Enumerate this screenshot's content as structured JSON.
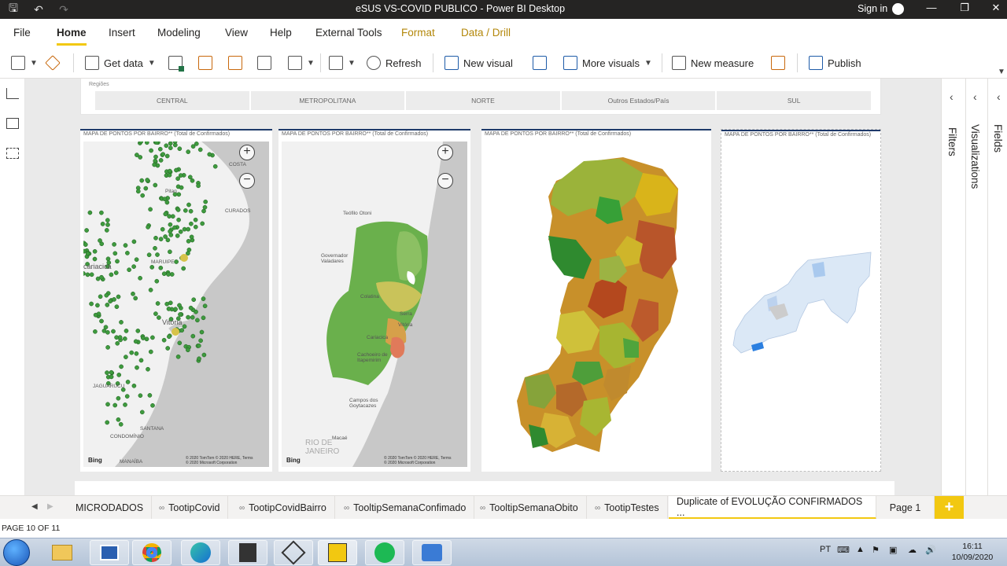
{
  "window": {
    "title": "eSUS VS-COVID PUBLICO - Power BI Desktop",
    "sign_in": "Sign in"
  },
  "ribbon_tabs": [
    "File",
    "Home",
    "Insert",
    "Modeling",
    "View",
    "Help",
    "External Tools",
    "Format",
    "Data / Drill"
  ],
  "active_ribbon_tab": "Home",
  "ribbon": {
    "get_data": "Get data",
    "refresh": "Refresh",
    "new_visual": "New visual",
    "more_visuals": "More visuals",
    "new_measure": "New measure",
    "publish": "Publish"
  },
  "slicer": {
    "title": "Regiões",
    "items": [
      "CENTRAL",
      "METROPOLITANA",
      "NORTE",
      "Outros Estados/País",
      "SUL"
    ]
  },
  "visuals": {
    "map1": {
      "title": "MAPA DE PONTOS POR BAIRRO** (Total de Confirmados)",
      "places": [
        "COSTA",
        "Pitan",
        "CURADOS",
        "MARUIPE",
        "cariacica",
        "Vitória",
        "JAGUARUCU",
        "CONDOMÍNIO",
        "SANTANA",
        "MANAÍBA"
      ]
    },
    "map2": {
      "title": "MAPA DE PONTOS POR BAIRRO** (Total de Confirmados)",
      "places": [
        "Teófilo Otoni",
        "Governador Valadares",
        "Colatina",
        "Vitória",
        "Cachoeiro de Itapemirim",
        "Campos dos Goytacazes",
        "Macaé",
        "RIO DE JANEIRO",
        "Serra",
        "Cariacica"
      ]
    },
    "map3": {
      "title": "MAPA DE PONTOS POR BAIRRO** (Total de Confirmados)"
    },
    "map4": {
      "title": "MAPA DE PONTOS POR BAIRRO** (Total de Confirmados)"
    },
    "bing": "Bing",
    "copyright": "© 2020 TomTom © 2020 HERE, Terms © 2020 Microsoft Corporation"
  },
  "panes": {
    "filters": "Filters",
    "visualizations": "Visualizations",
    "fields": "Fields"
  },
  "page_tabs": [
    {
      "label": "MICRODADOS",
      "tooltip": false
    },
    {
      "label": "TootipCovid",
      "tooltip": true
    },
    {
      "label": "TootipCovidBairro",
      "tooltip": true
    },
    {
      "label": "TooltipSemanaConfimado",
      "tooltip": true
    },
    {
      "label": "TooltipSemanaObito",
      "tooltip": true
    },
    {
      "label": "TootipTestes",
      "tooltip": true
    },
    {
      "label": "Duplicate of EVOLUÇÃO CONFIRMADOS ...",
      "tooltip": false,
      "active": true
    },
    {
      "label": "Page 1",
      "tooltip": false
    }
  ],
  "status": {
    "page_indicator": "PAGE 10 OF 11"
  },
  "taskbar": {
    "language": "PT",
    "time": "16:11",
    "date": "10/09/2020"
  },
  "colors": {
    "accent": "#f2c811",
    "titlebar": "#252423",
    "visual_topline": "#1f3a6a"
  }
}
